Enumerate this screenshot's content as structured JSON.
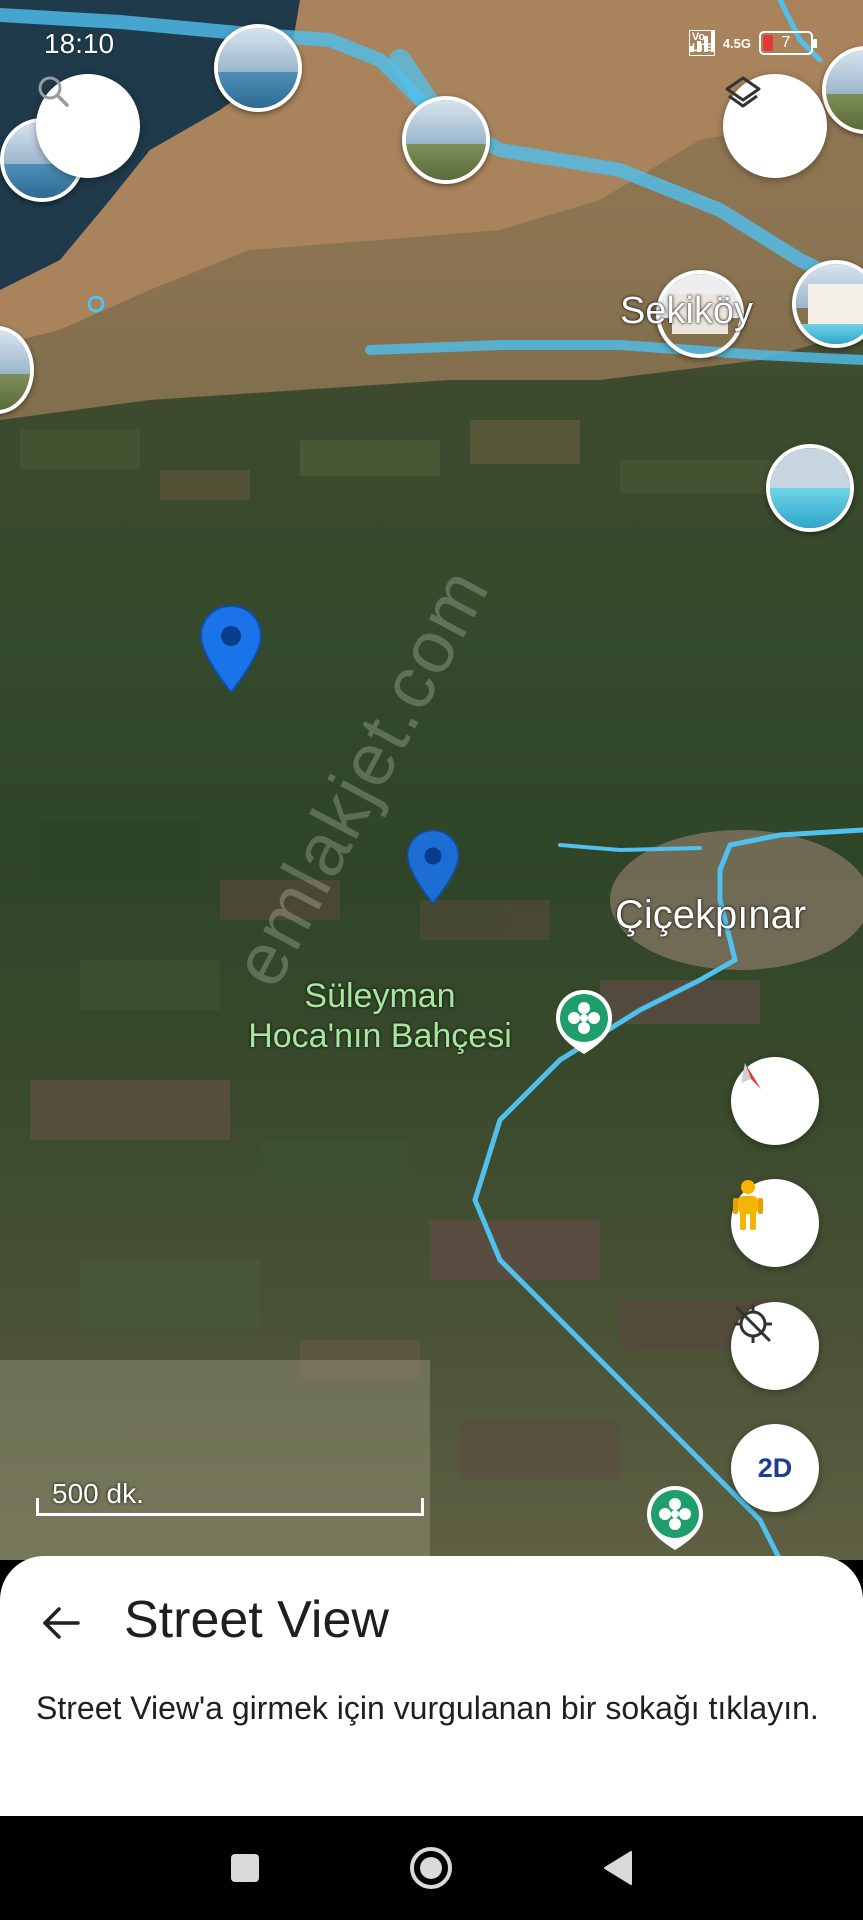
{
  "status_bar": {
    "time": "18:10",
    "volte": "Vo LTE",
    "network": "4.5G",
    "battery": "7"
  },
  "map": {
    "place_labels": [
      "Sekiköy",
      "Çiçekpınar"
    ],
    "poi": {
      "name_line1": "Süleyman",
      "name_line2": "Hoca'nın Bahçesi"
    },
    "watermark": "emlakjet.com",
    "scale_label": "500 dk.",
    "colors": {
      "street_view_line": "#4fc1ef",
      "pin_blue": "#1a73e8",
      "poi_green": "#1e9e6a"
    }
  },
  "controls": {
    "search_icon": "search-icon",
    "layers_icon": "layers-icon",
    "compass_icon": "compass-icon",
    "pegman_icon": "pegman-icon",
    "location_icon": "location-off-icon",
    "view_toggle_label": "2D"
  },
  "sheet": {
    "title": "Street View",
    "description": "Street View'a girmek için vurgulanan bir sokağı tıklayın."
  },
  "navbar": {
    "icons": [
      "recents-icon",
      "home-icon",
      "back-icon"
    ]
  }
}
